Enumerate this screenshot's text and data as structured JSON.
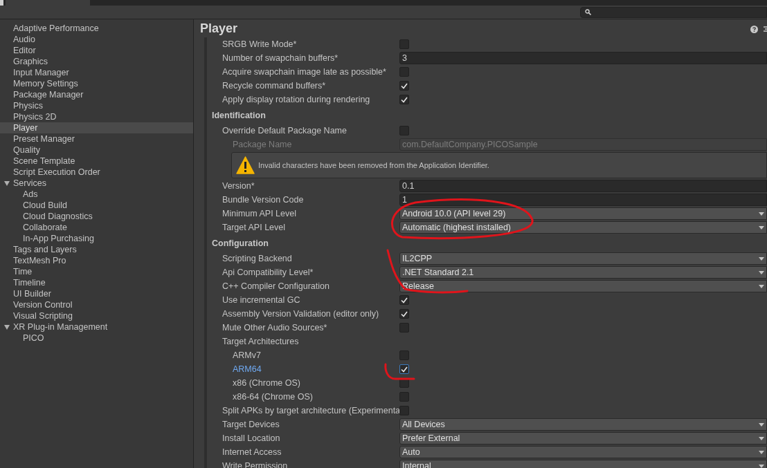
{
  "sidebar": {
    "items": [
      {
        "label": "Adaptive Performance",
        "selected": false
      },
      {
        "label": "Audio",
        "selected": false
      },
      {
        "label": "Editor",
        "selected": false
      },
      {
        "label": "Graphics",
        "selected": false
      },
      {
        "label": "Input Manager",
        "selected": false
      },
      {
        "label": "Memory Settings",
        "selected": false
      },
      {
        "label": "Package Manager",
        "selected": false
      },
      {
        "label": "Physics",
        "selected": false
      },
      {
        "label": "Physics 2D",
        "selected": false
      },
      {
        "label": "Player",
        "selected": true
      },
      {
        "label": "Preset Manager",
        "selected": false
      },
      {
        "label": "Quality",
        "selected": false
      },
      {
        "label": "Scene Template",
        "selected": false
      },
      {
        "label": "Script Execution Order",
        "selected": false
      },
      {
        "label": "Services",
        "selected": false,
        "expanded": true,
        "children": [
          {
            "label": "Ads",
            "selected": false
          },
          {
            "label": "Cloud Build",
            "selected": false
          },
          {
            "label": "Cloud Diagnostics",
            "selected": false
          },
          {
            "label": "Collaborate",
            "selected": false
          },
          {
            "label": "In-App Purchasing",
            "selected": false
          }
        ]
      },
      {
        "label": "Tags and Layers",
        "selected": false
      },
      {
        "label": "TextMesh Pro",
        "selected": false
      },
      {
        "label": "Time",
        "selected": false
      },
      {
        "label": "Timeline",
        "selected": false
      },
      {
        "label": "UI Builder",
        "selected": false
      },
      {
        "label": "Version Control",
        "selected": false
      },
      {
        "label": "Visual Scripting",
        "selected": false
      },
      {
        "label": "XR Plug-in Management",
        "selected": false,
        "expanded": true,
        "children": [
          {
            "label": "PICO",
            "selected": false
          }
        ]
      }
    ]
  },
  "panel": {
    "title": "Player",
    "sections": [
      {
        "rows": [
          {
            "kind": "checkbox",
            "label": "SRGB Write Mode*",
            "checked": false
          },
          {
            "kind": "text",
            "label": "Number of swapchain buffers*",
            "value": "3"
          },
          {
            "kind": "checkbox",
            "label": "Acquire swapchain image late as possible*",
            "checked": false
          },
          {
            "kind": "checkbox",
            "label": "Recycle command buffers*",
            "checked": true
          },
          {
            "kind": "checkbox",
            "label": "Apply display rotation during rendering",
            "checked": true
          }
        ]
      },
      {
        "title": "Identification",
        "rows": [
          {
            "kind": "checkbox",
            "label": "Override Default Package Name",
            "checked": false,
            "children": [
              {
                "kind": "readonly",
                "label": "Package Name",
                "value": "com.DefaultCompany.PICOSample"
              },
              {
                "kind": "warning",
                "message": "Invalid characters have been removed from the Application Identifier."
              }
            ]
          },
          {
            "kind": "text",
            "label": "Version*",
            "value": "0.1"
          },
          {
            "kind": "text",
            "label": "Bundle Version Code",
            "value": "1"
          },
          {
            "kind": "dropdown",
            "label": "Minimum API Level",
            "value": "Android 10.0 (API level 29)"
          },
          {
            "kind": "dropdown",
            "label": "Target API Level",
            "value": "Automatic (highest installed)"
          }
        ]
      },
      {
        "title": "Configuration",
        "rows": [
          {
            "kind": "dropdown",
            "label": "Scripting Backend",
            "value": "IL2CPP"
          },
          {
            "kind": "dropdown",
            "label": "Api Compatibility Level*",
            "value": ".NET Standard 2.1"
          },
          {
            "kind": "dropdown",
            "label": "C++ Compiler Configuration",
            "value": "Release"
          },
          {
            "kind": "checkbox",
            "label": "Use incremental GC",
            "checked": true
          },
          {
            "kind": "checkbox",
            "label": "Assembly Version Validation (editor only)",
            "checked": true
          },
          {
            "kind": "checkbox",
            "label": "Mute Other Audio Sources*",
            "checked": false
          },
          {
            "kind": "group",
            "label": "Target Architectures",
            "children": [
              {
                "kind": "checkbox",
                "label": "ARMv7",
                "checked": false,
                "focused": false
              },
              {
                "kind": "checkbox",
                "label": "ARM64",
                "checked": true,
                "focused": true
              },
              {
                "kind": "checkbox",
                "label": "x86 (Chrome OS)",
                "checked": false,
                "focused": false
              },
              {
                "kind": "checkbox",
                "label": "x86-64 (Chrome OS)",
                "checked": false,
                "focused": false
              }
            ]
          },
          {
            "kind": "checkbox",
            "label": "Split APKs by target architecture (Experimenta",
            "checked": false
          },
          {
            "kind": "dropdown",
            "label": "Target Devices",
            "value": "All Devices"
          },
          {
            "kind": "dropdown",
            "label": "Install Location",
            "value": "Prefer External"
          },
          {
            "kind": "dropdown",
            "label": "Internet Access",
            "value": "Auto"
          },
          {
            "kind": "dropdown",
            "label": "Write Permission",
            "value": "Internal"
          }
        ]
      }
    ]
  }
}
